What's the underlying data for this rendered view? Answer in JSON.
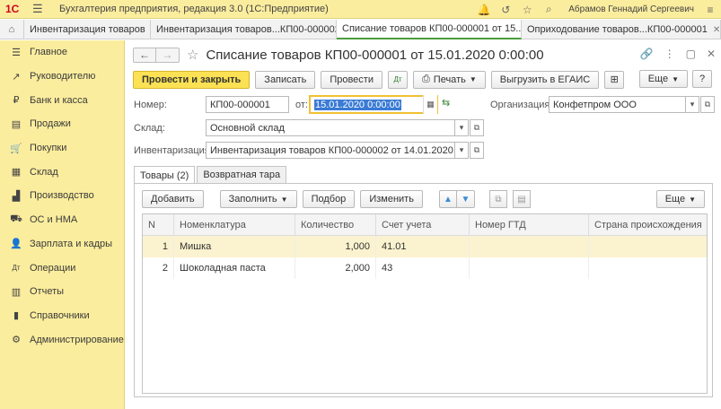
{
  "app": {
    "logo": "1С",
    "title": "Бухгалтерия предприятия, редакция 3.0  (1С:Предприятие)",
    "user": "Абрамов Геннадий Сергеевич"
  },
  "tabs": [
    {
      "label": "Инвентаризация товаров"
    },
    {
      "label": "Инвентаризация товаров...КП00-000002"
    },
    {
      "label": "Списание товаров КП00-000001 от 15..."
    },
    {
      "label": "Оприходование товаров...КП00-000001"
    }
  ],
  "sidebar": {
    "items": [
      {
        "label": "Главное",
        "icon": "☰"
      },
      {
        "label": "Руководителю",
        "icon": "↗"
      },
      {
        "label": "Банк и касса",
        "icon": "₽"
      },
      {
        "label": "Продажи",
        "icon": "▤"
      },
      {
        "label": "Покупки",
        "icon": "🛒"
      },
      {
        "label": "Склад",
        "icon": "▦"
      },
      {
        "label": "Производство",
        "icon": "▟"
      },
      {
        "label": "ОС и НМА",
        "icon": "⛟"
      },
      {
        "label": "Зарплата и кадры",
        "icon": "👤"
      },
      {
        "label": "Операции",
        "icon": "Дт"
      },
      {
        "label": "Отчеты",
        "icon": "▥"
      },
      {
        "label": "Справочники",
        "icon": "▮"
      },
      {
        "label": "Администрирование",
        "icon": "⚙"
      }
    ]
  },
  "document": {
    "title": "Списание товаров КП00-000001 от 15.01.2020 0:00:00",
    "toolbar": {
      "post_close": "Провести и закрыть",
      "save": "Записать",
      "post": "Провести",
      "print": "Печать",
      "egais": "Выгрузить в ЕГАИС",
      "more": "Еще"
    },
    "fields": {
      "number_label": "Номер:",
      "number_value": "КП00-000001",
      "date_label": "от:",
      "date_value": "15.01.2020  0:00:00",
      "org_label": "Организация:",
      "org_value": "Конфетпром ООО",
      "warehouse_label": "Склад:",
      "warehouse_value": "Основной склад",
      "inventory_label": "Инвентаризация:",
      "inventory_value": "Инвентаризация товаров КП00-000002 от 14.01.2020 12:00:0"
    },
    "subtabs": [
      {
        "label": "Товары (2)"
      },
      {
        "label": "Возвратная тара"
      }
    ],
    "table_toolbar": {
      "add": "Добавить",
      "fill": "Заполнить",
      "select": "Подбор",
      "change": "Изменить",
      "more": "Еще"
    },
    "table": {
      "columns": [
        "N",
        "Номенклатура",
        "Количество",
        "Счет учета",
        "Номер ГТД",
        "Страна происхождения"
      ],
      "rows": [
        {
          "n": "1",
          "item": "Мишка",
          "qty": "1,000",
          "account": "41.01",
          "gtd": "",
          "country": ""
        },
        {
          "n": "2",
          "item": "Шоколадная паста",
          "qty": "2,000",
          "account": "43",
          "gtd": "",
          "country": ""
        }
      ]
    }
  }
}
